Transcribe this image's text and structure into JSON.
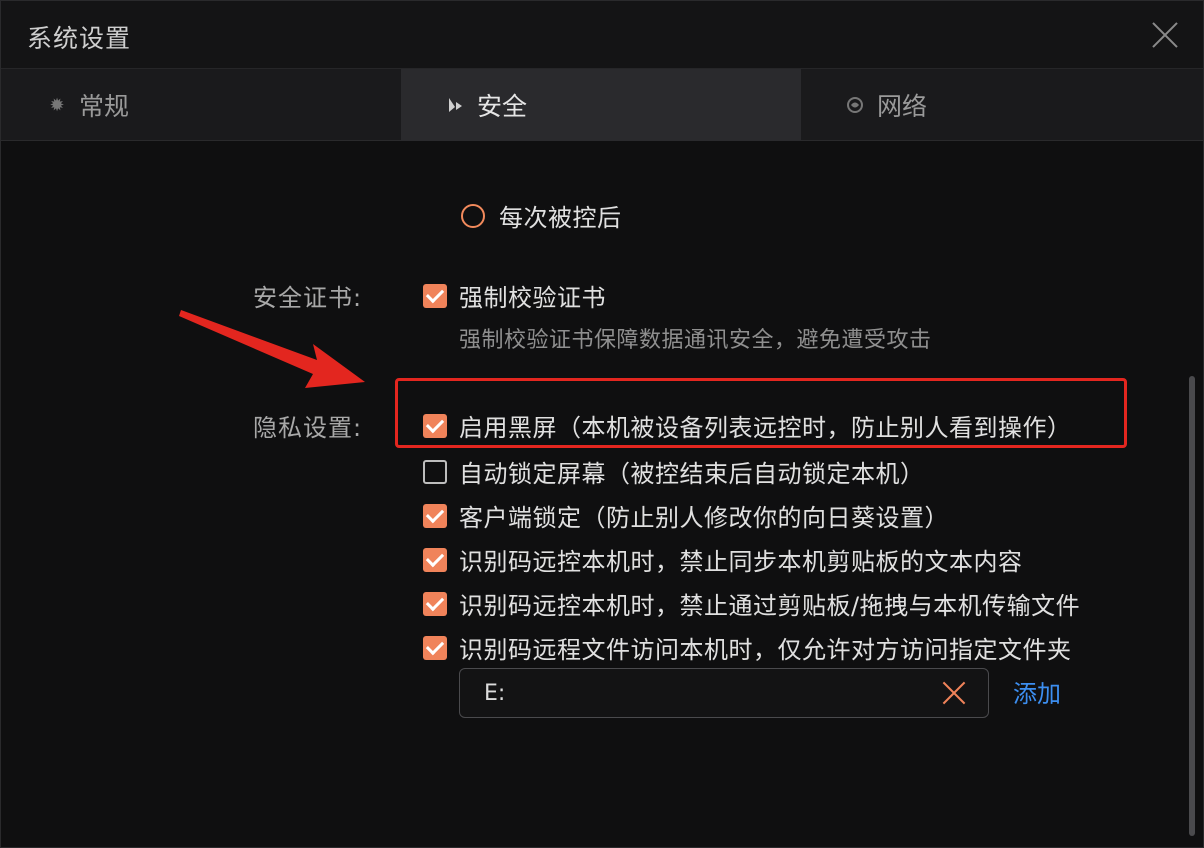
{
  "window": {
    "title": "系统设置"
  },
  "tabs": [
    {
      "label": "常规",
      "icon": "gear-icon"
    },
    {
      "label": "安全",
      "icon": "shield-icon",
      "active": true
    },
    {
      "label": "网络",
      "icon": "globe-icon"
    }
  ],
  "options": {
    "radio_after_control": "每次被控后",
    "cert_label": "安全证书:",
    "cert_force_check": "强制校验证书",
    "cert_desc": "强制校验证书保障数据通讯安全，避免遭受攻击",
    "privacy_label": "隐私设置:",
    "privacy_items": [
      {
        "text": "启用黑屏（本机被设备列表远控时，防止别人看到操作）",
        "checked": true
      },
      {
        "text": "自动锁定屏幕（被控结束后自动锁定本机）",
        "checked": false
      },
      {
        "text": "客户端锁定（防止别人修改你的向日葵设置）",
        "checked": true
      },
      {
        "text": "识别码远控本机时，禁止同步本机剪贴板的文本内容",
        "checked": true
      },
      {
        "text": "识别码远控本机时，禁止通过剪贴板/拖拽与本机传输文件",
        "checked": true
      },
      {
        "text": "识别码远程文件访问本机时，仅允许对方访问指定文件夹",
        "checked": true
      }
    ],
    "folder_value": "E:",
    "add_label": "添加"
  },
  "colors": {
    "accent": "#f0835a",
    "highlight": "#e3261f",
    "link": "#3c8ef0"
  }
}
